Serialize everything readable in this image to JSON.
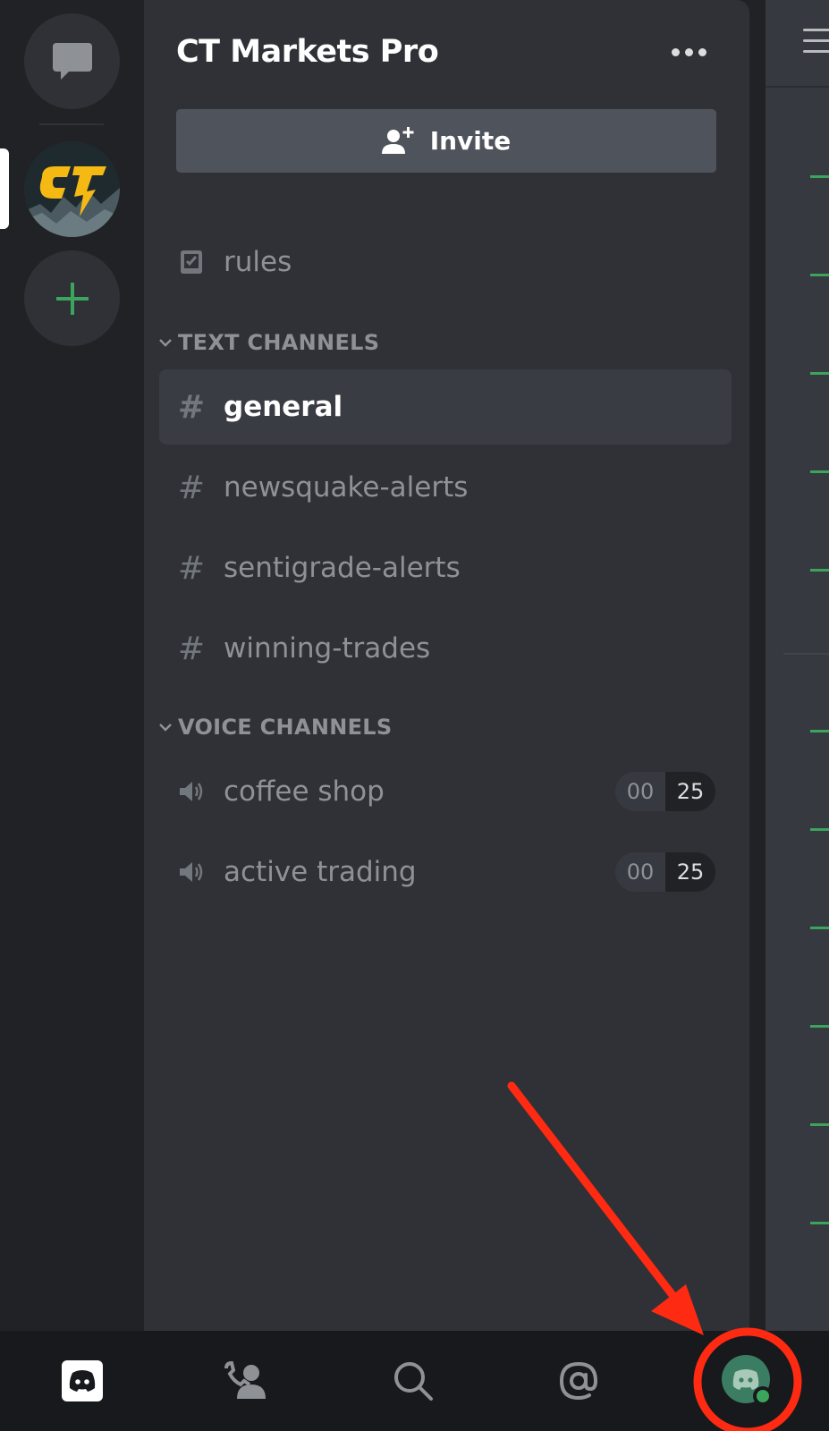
{
  "server": {
    "name": "CT Markets Pro"
  },
  "guilds": {
    "logo_text": "CT"
  },
  "invite_label": "Invite",
  "rules_channel": "rules",
  "text_category": "TEXT CHANNELS",
  "text_channels": [
    {
      "name": "general",
      "active": true
    },
    {
      "name": "newsquake-alerts"
    },
    {
      "name": "sentigrade-alerts"
    },
    {
      "name": "winning-trades"
    }
  ],
  "voice_category": "VOICE CHANNELS",
  "voice_channels": [
    {
      "name": "coffee shop",
      "current": "00",
      "limit": "25"
    },
    {
      "name": "active trading",
      "current": "00",
      "limit": "25"
    }
  ],
  "colors": {
    "accent_green": "#3ba55d",
    "annotation_red": "#ff2a12",
    "logo_yellow": "#f5b914"
  }
}
